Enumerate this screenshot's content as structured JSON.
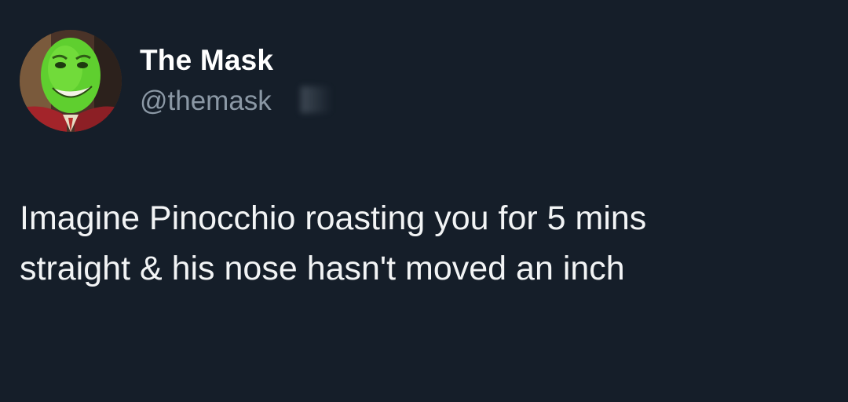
{
  "tweet": {
    "author": {
      "display_name": "The Mask",
      "handle": "@themask",
      "avatar_icon": "green-mask-face-avatar"
    },
    "text": "Imagine Pinocchio roasting you for 5 mins\nstraight & his nose hasn't moved an inch"
  },
  "colors": {
    "background": "#151e29",
    "name": "#ffffff",
    "handle": "#8b98a5",
    "text": "#f2f4f5"
  }
}
